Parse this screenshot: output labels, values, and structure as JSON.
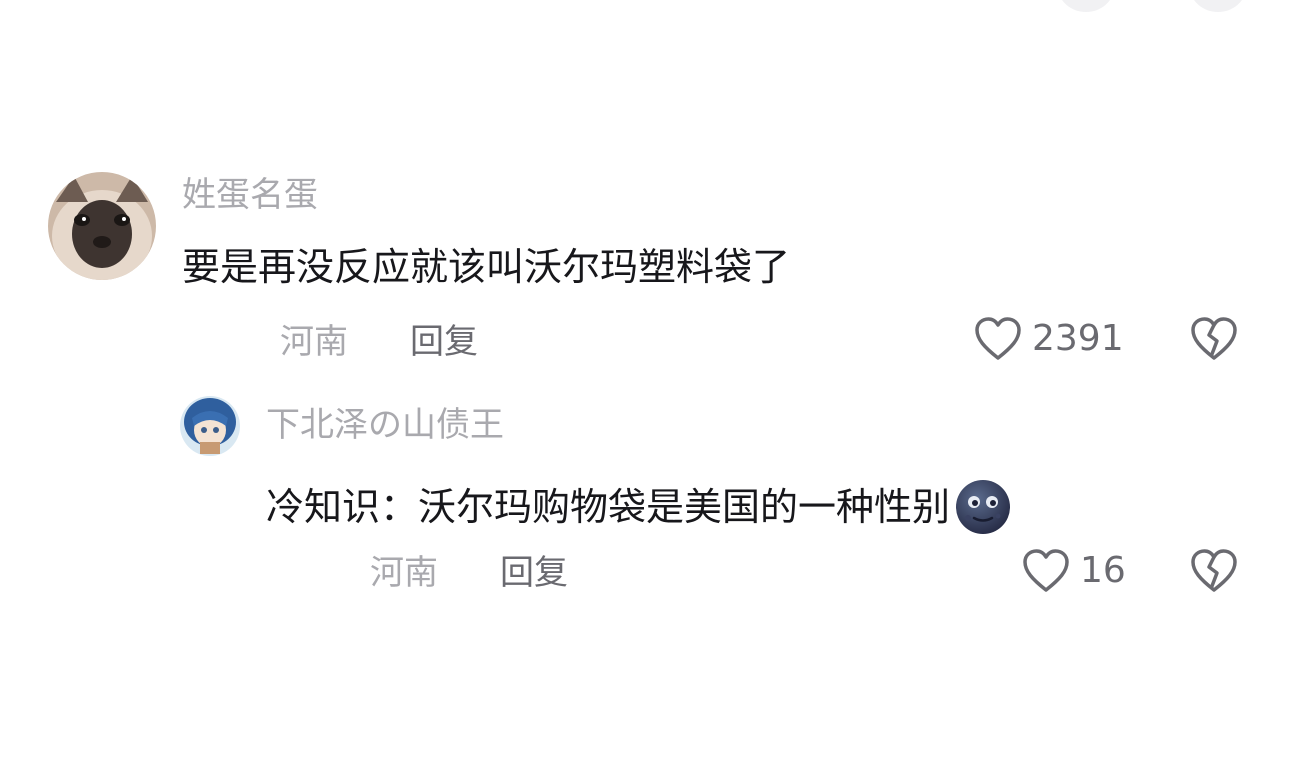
{
  "comments": [
    {
      "username": "姓蛋名蛋",
      "text": "要是再没反应就该叫沃尔玛塑料袋了",
      "location": "河南",
      "reply_label": "回复",
      "like_count": "2391"
    },
    {
      "username": "下北泽の山债王",
      "text": "冷知识：沃尔玛购物袋是美国的一种性别",
      "location": "河南",
      "reply_label": "回复",
      "like_count": "16"
    }
  ],
  "icons": {
    "like": "heart-outline-icon",
    "dislike": "broken-heart-outline-icon",
    "emoji": "new-moon-face-emoji"
  },
  "colors": {
    "username": "#a9a9ae",
    "text": "#17171b",
    "meta": "#6a6a70"
  }
}
